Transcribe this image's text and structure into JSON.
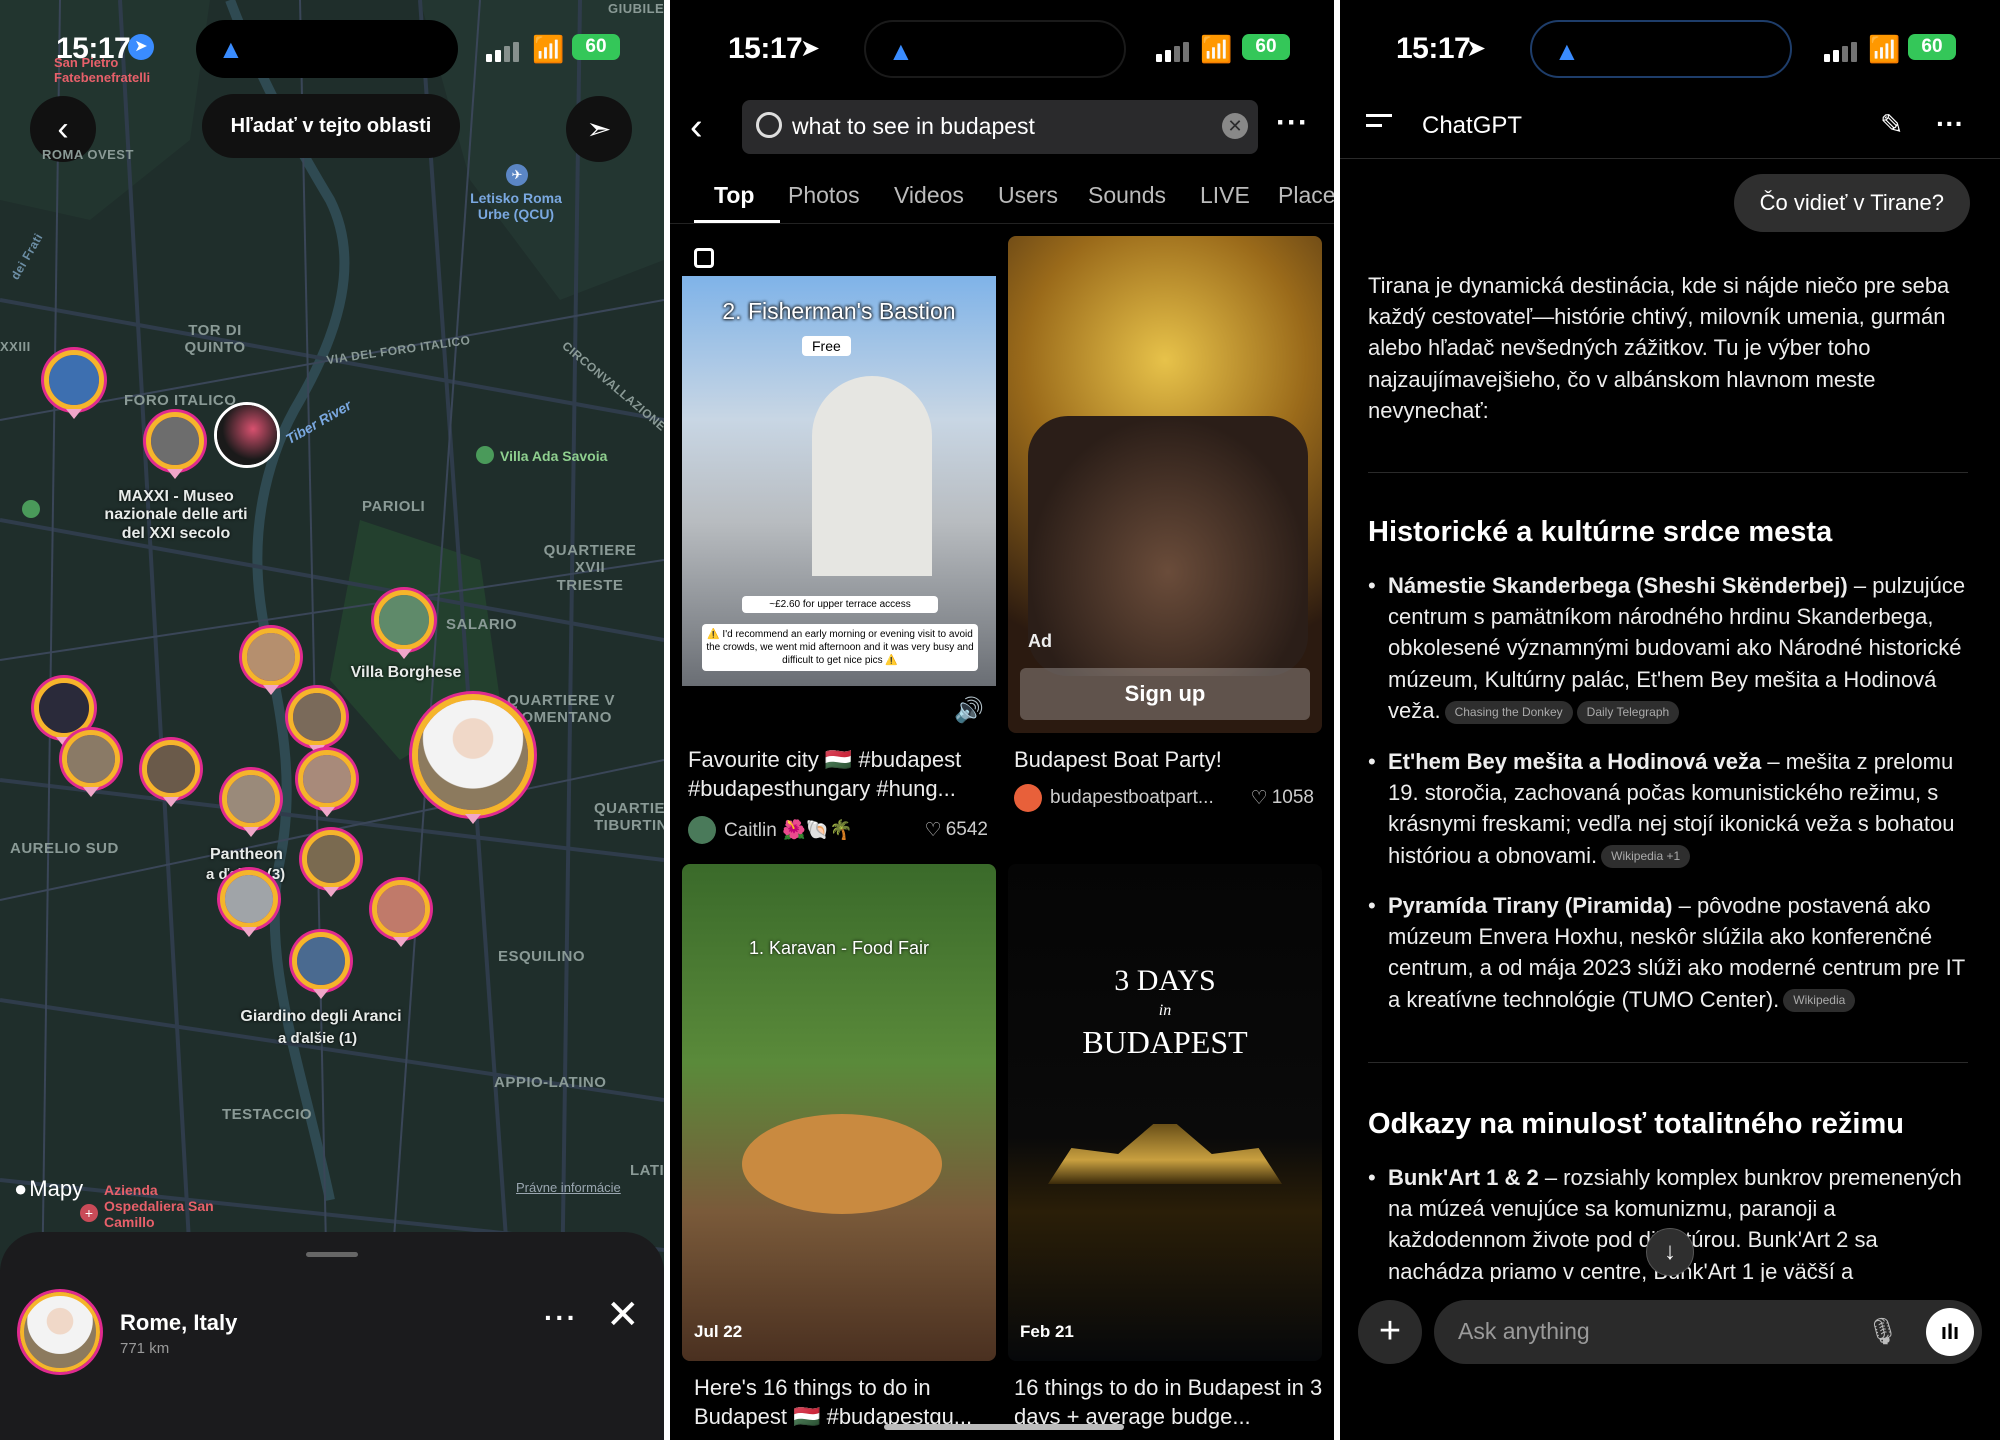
{
  "status": {
    "time": "15:17",
    "battery": "60"
  },
  "map": {
    "search_area_label": "Hľadať v tejto oblasti",
    "places": {
      "hospital_top": "San Pietro Fatebenefratelli",
      "giubile": "GIUBILE",
      "roma_ovest": "ROMA OVEST",
      "xxiii": "XXIII",
      "dei_frati": "dei Frati",
      "airport": "Letisko Roma Urbe (QCU)",
      "tor_di_quinto": "TOR DI QUINTO",
      "via_foro_italico": "VIA DEL FORO ITALICO",
      "circonvallazione": "CIRCONVALLAZIONE",
      "foro_italico": "FORO ITALICO",
      "tiber": "Tiber River",
      "villa_ada": "Villa Ada Savoia",
      "maxxi": "MAXXI - Museo nazionale delle arti del XXI secolo",
      "parioli": "PARIOLI",
      "quartiere_xvii": "QUARTIERE XVII TRIESTE",
      "salario": "SALARIO",
      "villa_borghese": "Villa Borghese",
      "quartiere_v": "QUARTIERE V NOMENTANO",
      "pantheon": "Pantheon",
      "pantheon_more": "a ďalšie (3)",
      "quartiere_tib": "QUARTIERE TIBURTINO",
      "aurelio": "AURELIO SUD",
      "esquilino": "ESQUILINO",
      "giardino": "Giardino degli Aranci",
      "giardino_more": "a ďalšie (1)",
      "appio": "APPIO-LATINO",
      "testaccio": "TESTACCIO",
      "latina": "LATI",
      "hospital_bottom": "Azienda Ospedaliera San Camillo",
      "legal": "Právne informácie",
      "maps_brand": "Mapy"
    },
    "sheet": {
      "title": "Rome, Italy",
      "distance": "771 km"
    }
  },
  "tiktok": {
    "search_value": "what to see in budapest",
    "tabs": [
      "Top",
      "Photos",
      "Videos",
      "Users",
      "Sounds",
      "LIVE",
      "Places"
    ],
    "cards": [
      {
        "overlay_title": "2. Fisherman's Bastion",
        "badge": "Free",
        "note1": "~£2.60 for upper terrace access",
        "note2": "⚠️ I'd recommend an early morning or evening visit to avoid the crowds, we went mid afternoon and it was very busy and difficult to get nice pics ⚠️",
        "caption": "Favourite city 🇭🇺 #budapest #budapesthungary #hung...",
        "author": "Caitlin 🌺🐚🌴",
        "likes": "6542"
      },
      {
        "ad_label": "Ad",
        "cta": "Sign up",
        "caption": "Budapest Boat Party!",
        "author": "budapestboatpart...",
        "likes": "1058"
      },
      {
        "overlay_title": "1. Karavan - Food Fair",
        "date": "Jul 22",
        "caption": "Here's 16 things to do in Budapest 🇭🇺 #budapestgu..."
      },
      {
        "overlay_line1": "3 DAYS",
        "overlay_line2": "in",
        "overlay_line3": "BUDAPEST",
        "date": "Feb 21",
        "caption": "16 things to do in Budapest in 3 days + average budge..."
      }
    ]
  },
  "chatgpt": {
    "title": "ChatGPT",
    "user_msg": "Čo vidieť v Tirane?",
    "intro": "Tirana je dynamická destinácia, kde si nájde niečo pre seba každý cestovateľ—histórie chtivý, milovník umenia, gurmán alebo hľadač nevšedných zážitkov. Tu je výber toho najzaujímavejšieho, čo v albánskom hlavnom meste nevynechať:",
    "h1": "Historické a kultúrne srdce mesta",
    "b1_bold": "Námestie Skanderbega (Sheshi Skënderbej)",
    "b1_text": " – pulzujúce centrum s pamätníkom národného hrdinu Skanderbega, obkolesené významnými budovami ako Národné historické múzeum, Kultúrny palác, Et'hem Bey mešita a Hodinová veža.",
    "b1_src1": "Chasing the Donkey",
    "b1_src2": "Daily Telegraph",
    "b2_bold": "Et'hem Bey mešita a Hodinová veža",
    "b2_text": " – mešita z prelomu 19. storočia, zachovaná počas komunistického režimu, s krásnymi freskami; vedľa nej stojí ikonická veža s bohatou históriou a obnovami.",
    "b2_src": "Wikipedia +1",
    "b3_bold": "Pyramída Tirany (Piramida)",
    "b3_text": " – pôvodne postavená ako múzeum Envera Hoxhu, neskôr slúžila ako konferenčné centrum, a od mája 2023 slúži ako moderné centrum pre IT a kreatívne technológie (TUMO Center).",
    "b3_src": "Wikipedia",
    "h2": "Odkazy na minulosť totalitného režimu",
    "b4_bold": "Bunk'Art 1 & 2",
    "b4_text": " – rozsiahly komplex bunkrov premenených na múzeá venujúce sa komunizmu, paranoji a každodennom živote pod diktatúrou. Bunk'Art 2 sa nachádza priamo v centre, Bunk'Art 1 je väčší a",
    "input_placeholder": "Ask anything"
  },
  "colors": {
    "map_bg": "#1f2e2b",
    "accent_blue": "#3a8cff",
    "battery": "#34c759",
    "pin_ring": "#e02a8f",
    "pin_gold": "#f5b52b"
  }
}
